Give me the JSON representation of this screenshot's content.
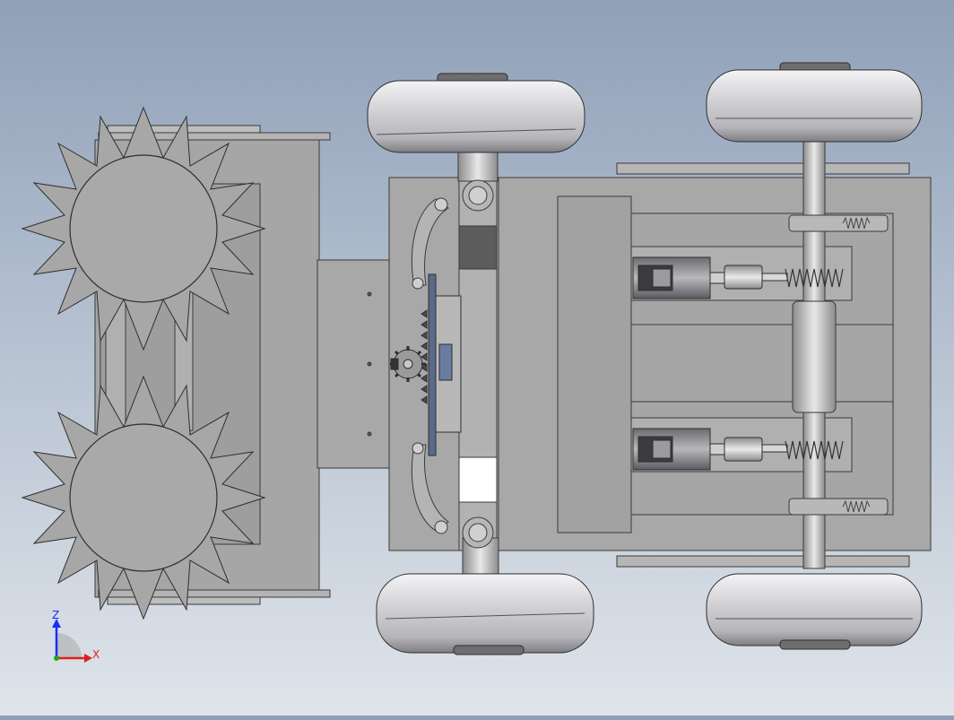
{
  "viewport": {
    "background_top": "#8fa0b8",
    "background_bottom": "#dfe4ea",
    "part_fill": "#a9a9a9",
    "part_stroke": "#3a3a3a"
  },
  "triad": {
    "z_label": "Z",
    "x_label": "X",
    "z_color": "#1a2cff",
    "x_color": "#e0201a",
    "y_color": "#18a818"
  },
  "model": {
    "icons": [
      "spiked-roller",
      "tire",
      "gear",
      "motor",
      "spring",
      "rack"
    ]
  }
}
